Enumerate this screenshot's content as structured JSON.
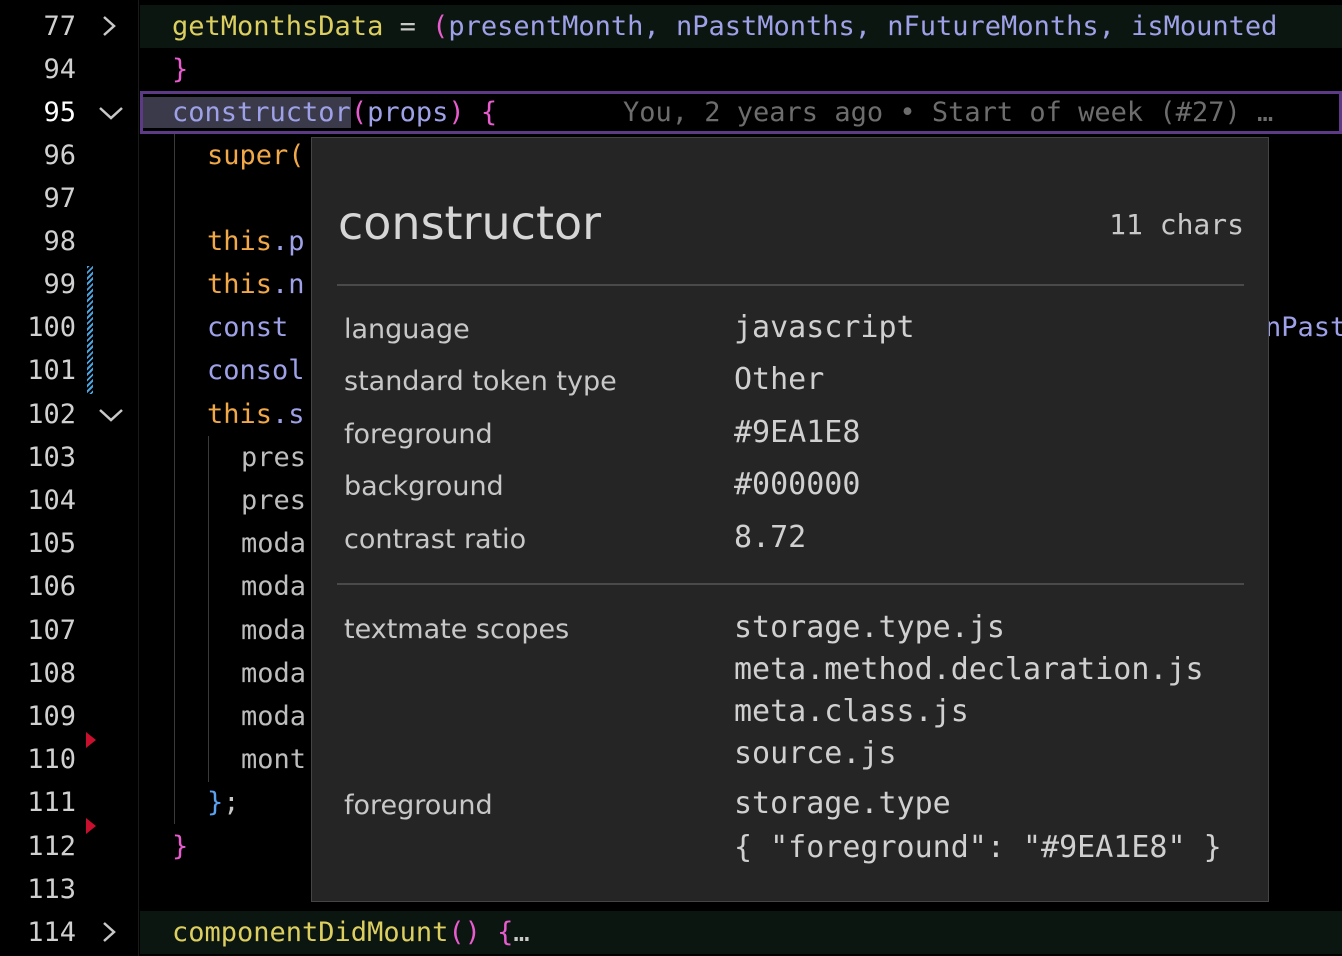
{
  "editor": {
    "lines": [
      {
        "num": "77",
        "fold": "collapsed",
        "folded": true
      },
      {
        "num": "94"
      },
      {
        "num": "95",
        "fold": "expanded",
        "active": true
      },
      {
        "num": "96"
      },
      {
        "num": "97"
      },
      {
        "num": "98"
      },
      {
        "num": "99"
      },
      {
        "num": "100"
      },
      {
        "num": "101"
      },
      {
        "num": "102",
        "fold": "expanded"
      },
      {
        "num": "103"
      },
      {
        "num": "104"
      },
      {
        "num": "105"
      },
      {
        "num": "106"
      },
      {
        "num": "107"
      },
      {
        "num": "108"
      },
      {
        "num": "109"
      },
      {
        "num": "110"
      },
      {
        "num": "111"
      },
      {
        "num": "112"
      },
      {
        "num": "113"
      },
      {
        "num": "114",
        "fold": "collapsed",
        "folded": true
      }
    ],
    "code": {
      "l77_name": "getMonthsData",
      "l77_eq": " = ",
      "l77_paren": "(",
      "l77_params": "presentMonth, nPastMonths, nFutureMonths, isMounted",
      "l94_brace": "}",
      "l95_name": "constructor",
      "l95_paren_open": "(",
      "l95_param": "props",
      "l95_paren_close": ")",
      "l95_brace": " {",
      "l95_blame": "You, 2 years ago • Start of week (#27) …",
      "l96": "super(",
      "l98_this": "this",
      "l98_rest": ".p",
      "l99_this": "this",
      "l99_rest": ".n",
      "l100_kw": "const",
      "l100_tail": "nPast",
      "l101": "consol",
      "l102_this": "this",
      "l102_rest": ".s",
      "l103": "pres",
      "l104": "pres",
      "l105": "moda",
      "l106": "moda",
      "l107": "moda",
      "l108": "moda",
      "l109": "moda",
      "l110": "mont",
      "l111_brace": "}",
      "l111_semi": ";",
      "l112_brace": "}",
      "l114_name": "componentDidMount",
      "l114_paren": "()",
      "l114_brace": " {",
      "l114_ellipsis": "…"
    }
  },
  "hover": {
    "title": "constructor",
    "chars": "11 chars",
    "rows": [
      {
        "key": "language",
        "value": "javascript"
      },
      {
        "key": "standard token type",
        "value": "Other"
      },
      {
        "key": "foreground",
        "value": "#9EA1E8"
      },
      {
        "key": "background",
        "value": "#000000"
      },
      {
        "key": "contrast ratio",
        "value": "8.72"
      }
    ],
    "scopes_label": "textmate scopes",
    "scopes": [
      "storage.type.js",
      "meta.method.declaration.js",
      "meta.class.js",
      "source.js"
    ],
    "fg_label": "foreground",
    "fg_rule": "storage.type",
    "fg_json": "{ \"foreground\": \"#9EA1E8\" }"
  },
  "colors": {
    "keyword": "#9EA1E8",
    "function": "#DCCF60",
    "this": "#F0A848",
    "bracket": "#E85CCF",
    "cursor_border": "#5C3A86"
  }
}
